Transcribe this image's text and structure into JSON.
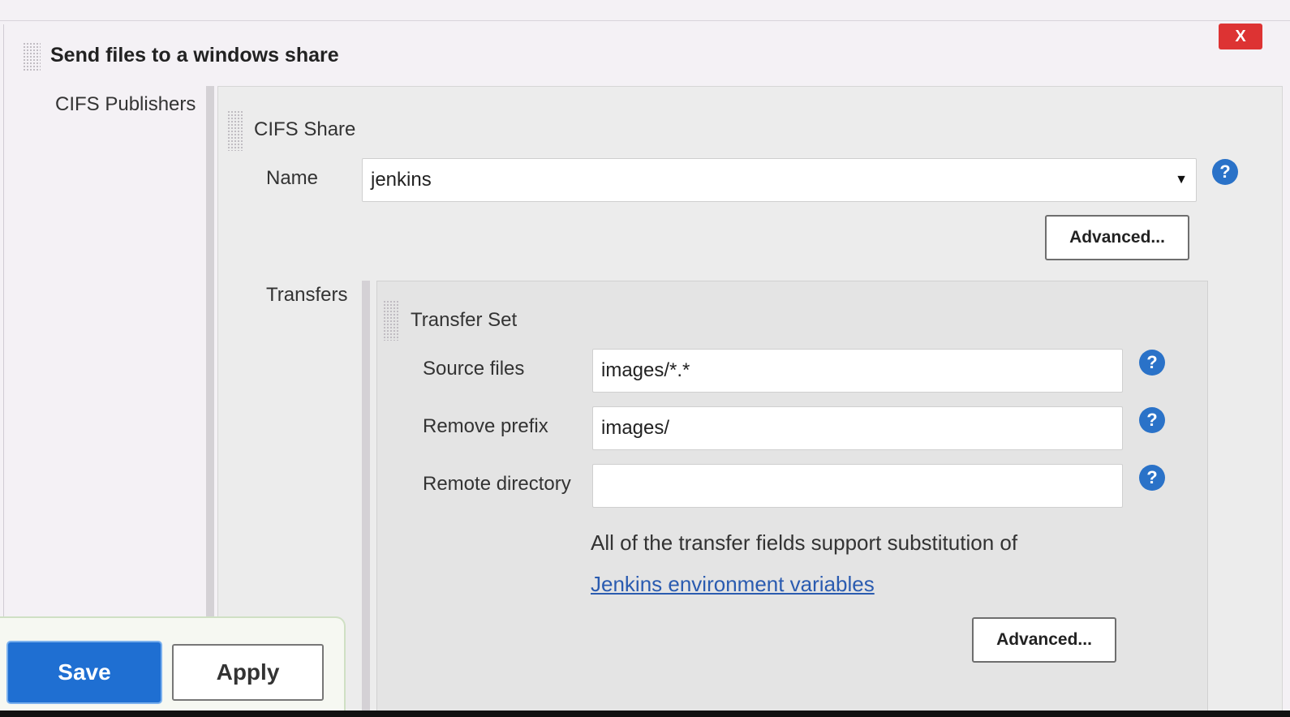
{
  "publisher": {
    "title": "Send files to a windows share",
    "close_label": "X",
    "cifs_publishers_label": "CIFS Publishers"
  },
  "cifs_share": {
    "title": "CIFS Share",
    "name_label": "Name",
    "name_value": "jenkins",
    "advanced_label": "Advanced...",
    "transfers_label": "Transfers"
  },
  "transfer_set": {
    "title": "Transfer Set",
    "source_files_label": "Source files",
    "source_files_value": "images/*.*",
    "remove_prefix_label": "Remove prefix",
    "remove_prefix_value": "images/",
    "remote_directory_label": "Remote directory",
    "remote_directory_value": "",
    "note_text": "All of the transfer fields support substitution of",
    "env_link_text": "Jenkins environment variables",
    "advanced_label": "Advanced..."
  },
  "help_icon_glyph": "?",
  "footer": {
    "save_label": "Save",
    "apply_label": "Apply"
  },
  "colors": {
    "save_button": "#1f6fd2",
    "close_button": "#dd3333",
    "help_icon": "#2a72c8",
    "link": "#2a5bb0"
  }
}
